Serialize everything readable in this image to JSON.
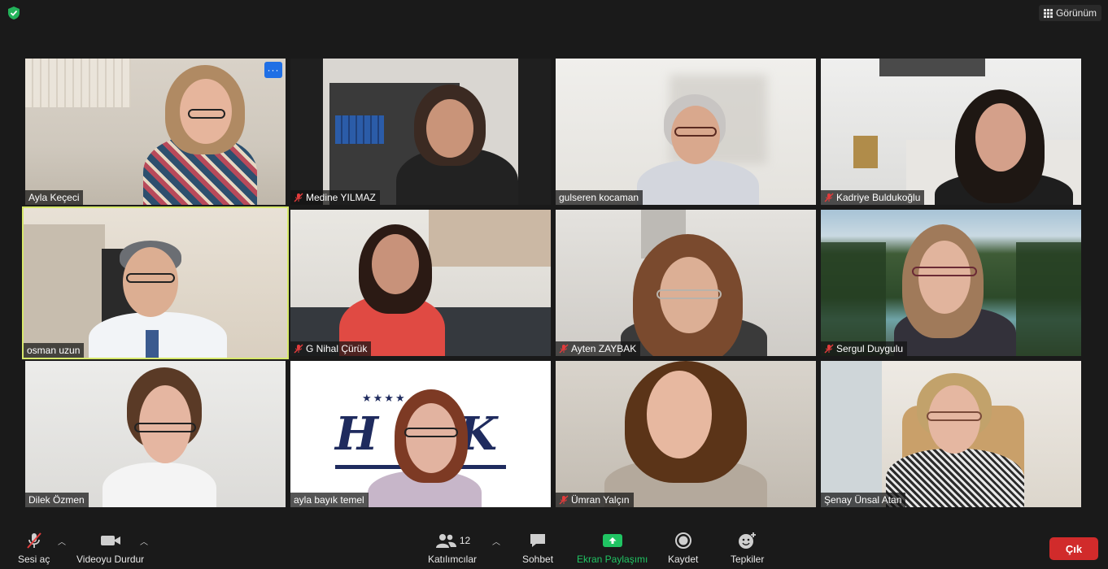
{
  "top": {
    "view_label": "Görünüm"
  },
  "participants": [
    {
      "name": "Ayla Keçeci",
      "muted": false,
      "active": false
    },
    {
      "name": "Medine YILMAZ",
      "muted": true,
      "active": false
    },
    {
      "name": "gulseren kocaman",
      "muted": false,
      "active": false
    },
    {
      "name": "Kadriye Buldukoğlu",
      "muted": true,
      "active": false
    },
    {
      "name": "osman uzun",
      "muted": false,
      "active": true
    },
    {
      "name": "G Nihal Çürük",
      "muted": true,
      "active": false
    },
    {
      "name": "Ayten ZAYBAK",
      "muted": true,
      "active": false
    },
    {
      "name": "Sergul Duygulu",
      "muted": true,
      "active": false
    },
    {
      "name": "Dilek Özmen",
      "muted": false,
      "active": false
    },
    {
      "name": "ayla bayık temel",
      "muted": false,
      "active": false
    },
    {
      "name": "Ümran Yalçın",
      "muted": true,
      "active": false
    },
    {
      "name": "Şenay Ünsal Atan",
      "muted": false,
      "active": false
    }
  ],
  "tile_more_label": "···",
  "toolbar": {
    "audio_label": "Sesi aç",
    "video_label": "Videoyu Durdur",
    "participants_label": "Katılımcılar",
    "participants_count": "12",
    "chat_label": "Sohbet",
    "share_label": "Ekran Paylaşımı",
    "record_label": "Kaydet",
    "reactions_label": "Tepkiler",
    "leave_label": "Çık"
  },
  "colors": {
    "share_green": "#20c463",
    "leave_red": "#d12b2b",
    "active_speaker": "#d7e86b"
  }
}
